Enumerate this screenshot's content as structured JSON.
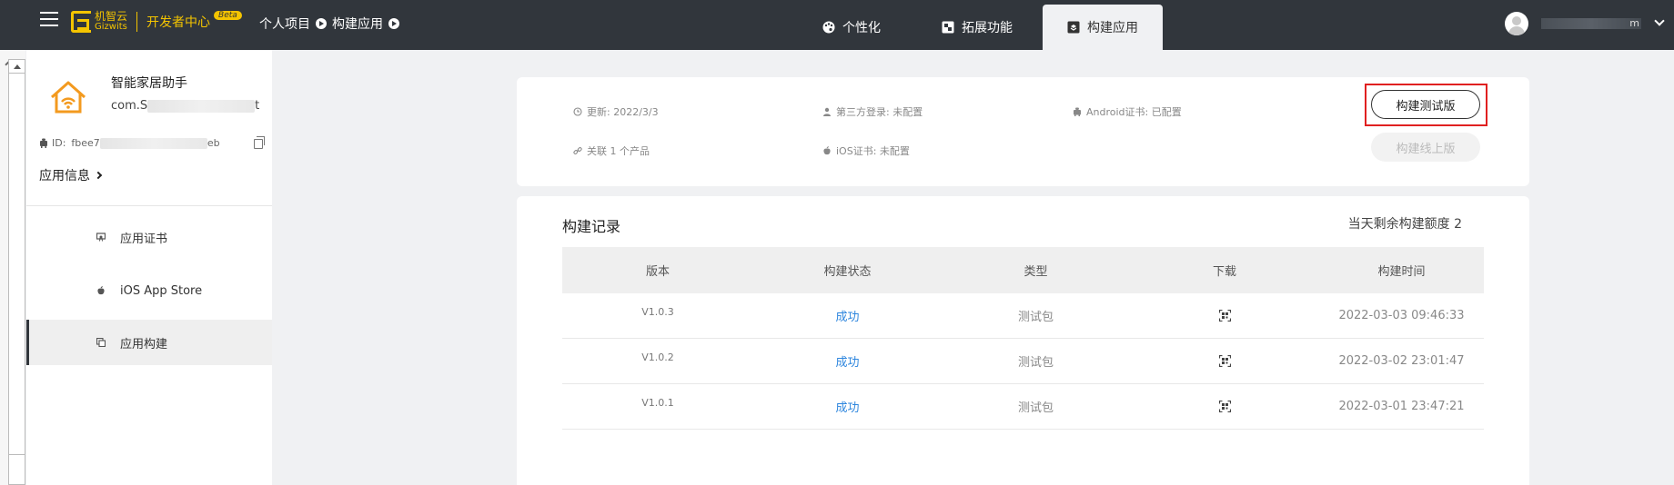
{
  "topbar": {
    "logo_cn": "机智云",
    "logo_en": "Gizwits",
    "dev_center": "开发者中心",
    "beta": "Beta",
    "breadcrumb": [
      "个人项目",
      "构建应用"
    ],
    "tabs": [
      {
        "label": "个性化",
        "icon": "palette-icon"
      },
      {
        "label": "拓展功能",
        "icon": "extension-icon"
      },
      {
        "label": "构建应用",
        "icon": "build-box-icon",
        "active": true
      }
    ],
    "user_name_suffix": "m"
  },
  "sidebar": {
    "app_name": "智能家居助手",
    "package_prefix": "com.S",
    "package_suffix": "t",
    "id_label": "ID:",
    "id_prefix": "fbee7",
    "id_suffix": "eb",
    "app_info": "应用信息",
    "menu": [
      {
        "label": "应用证书",
        "icon": "certificate-icon"
      },
      {
        "label": "iOS App Store",
        "icon": "apple-icon"
      },
      {
        "label": "应用构建",
        "icon": "copy-stack-icon",
        "active": true
      }
    ]
  },
  "summary": {
    "updated": "更新: 2022/3/3",
    "linked": "关联 1 个产品",
    "third_party_login": "第三方登录: 未配置",
    "ios_cert": "iOS证书: 未配置",
    "android_cert": "Android证书: 已配置",
    "build_test_button": "构建测试版",
    "build_online_button": "构建线上版"
  },
  "records": {
    "title": "构建记录",
    "quota": "当天剩余构建额度 2",
    "columns": [
      "版本",
      "构建状态",
      "类型",
      "下载",
      "构建时间"
    ],
    "rows": [
      {
        "version": "V1.0.3",
        "status": "成功",
        "type": "测试包",
        "time": "2022-03-03 09:46:33"
      },
      {
        "version": "V1.0.2",
        "status": "成功",
        "type": "测试包",
        "time": "2022-03-02 23:01:47"
      },
      {
        "version": "V1.0.1",
        "status": "成功",
        "type": "测试包",
        "time": "2022-03-01 23:47:21"
      }
    ]
  },
  "colors": {
    "topbar_bg": "#31363c",
    "brand_yellow": "#f4c400",
    "link_blue": "#2e86de",
    "highlight_red": "#e02020"
  }
}
